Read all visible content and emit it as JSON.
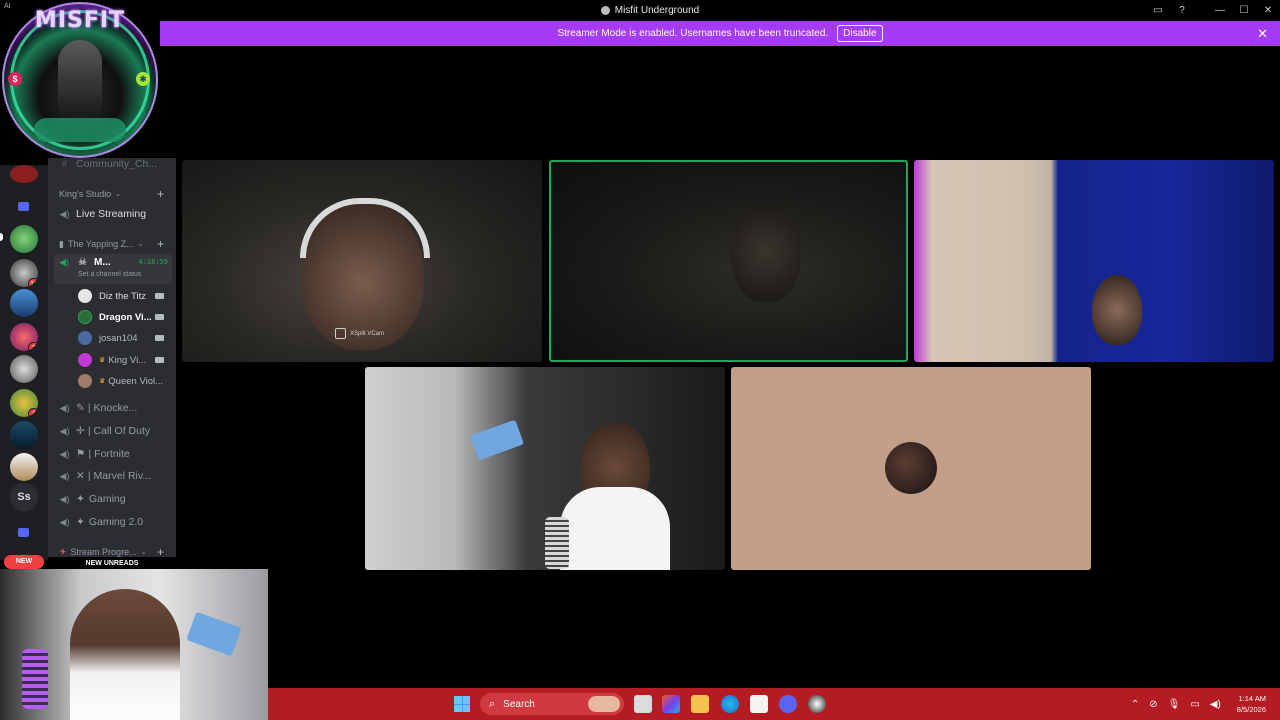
{
  "window": {
    "title": "Misfit Underground",
    "corner_tag": "AI"
  },
  "banner": {
    "message": "Streamer Mode is enabled. Usernames have been truncated.",
    "button_label": "Disable"
  },
  "overlay_logo": {
    "text": "MISFIT"
  },
  "servers": {
    "badges": [
      "10",
      "2",
      "1"
    ],
    "text_server": "Ss",
    "new_label": "NEW"
  },
  "channels": {
    "top_truncated": "Community_Ch...",
    "categories": [
      {
        "name": "King's Studio"
      },
      {
        "name": "The Yapping Z..."
      },
      {
        "name": "Stream Progre..."
      }
    ],
    "live_streaming": "Live Streaming",
    "active_voice": {
      "name": "M...",
      "timer": "4:18:59",
      "status": "Set a channel status"
    },
    "voice_users": [
      {
        "name": "Diz the Titz",
        "color": "#e6e6e6"
      },
      {
        "name": "Dragon Vi...",
        "color": "#f2f3f5",
        "bold": true
      },
      {
        "name": "josan104",
        "color": "#b5bac1"
      },
      {
        "name": "King Vi...",
        "color": "#b5bac1"
      },
      {
        "name": "Queen Viol...",
        "color": "#b5bac1"
      }
    ],
    "voice_channels": [
      {
        "name": "Knocke...",
        "prefix": "|"
      },
      {
        "name": "Call Of Duty",
        "prefix": "|"
      },
      {
        "name": "Fortnite",
        "prefix": "|"
      },
      {
        "name": "Marvel Riv...",
        "prefix": "|"
      },
      {
        "name": "Gaming",
        "prefix": ""
      },
      {
        "name": "Gaming 2.0",
        "prefix": ""
      }
    ],
    "new_unreads": "NEW UNREADS"
  },
  "video": {
    "tile1_watermark": "XSplit VCam"
  },
  "taskbar": {
    "search_label": "Search",
    "time": "1:14 AM",
    "date": "8/5/2026"
  }
}
